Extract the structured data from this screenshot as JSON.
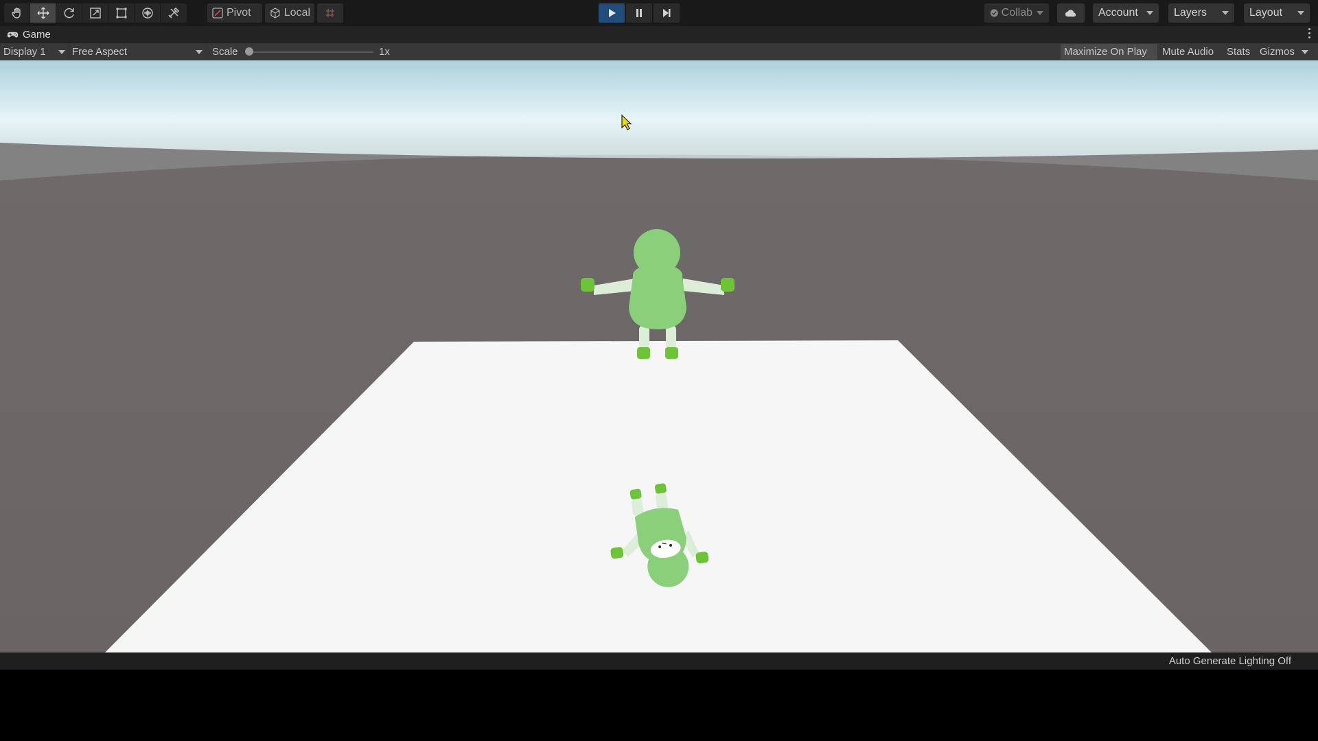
{
  "toolbar": {
    "tools": [
      "hand-icon",
      "move-icon",
      "rotate-icon",
      "scale-icon",
      "rect-icon",
      "transform-icon",
      "custom-tool-icon"
    ],
    "pivot_label": "Pivot",
    "local_label": "Local",
    "collab_label": "Collab",
    "account_label": "Account",
    "layers_label": "Layers",
    "layout_label": "Layout"
  },
  "play_controls": {
    "play_icon": "play-icon",
    "pause_icon": "pause-icon",
    "step_icon": "step-icon",
    "active_color": "#224c79"
  },
  "tab": {
    "label": "Game",
    "icon": "gamepad-icon"
  },
  "game_toolbar": {
    "display_label": "Display 1",
    "aspect_label": "Free Aspect",
    "scale_label": "Scale",
    "scale_value": "1x",
    "maximize_label": "Maximize On Play",
    "mute_label": "Mute Audio",
    "stats_label": "Stats",
    "gizmos_label": "Gizmos"
  },
  "scene": {
    "sky_color": "#e3f3f7",
    "ground_color": "#6a6565",
    "plane_color": "#f6f6f6",
    "character_body_color": "#8ad07a",
    "character_limb_color": "#ddeed8",
    "character_hand_color": "#6cc436"
  },
  "status": {
    "text": "Auto Generate Lighting Off"
  }
}
